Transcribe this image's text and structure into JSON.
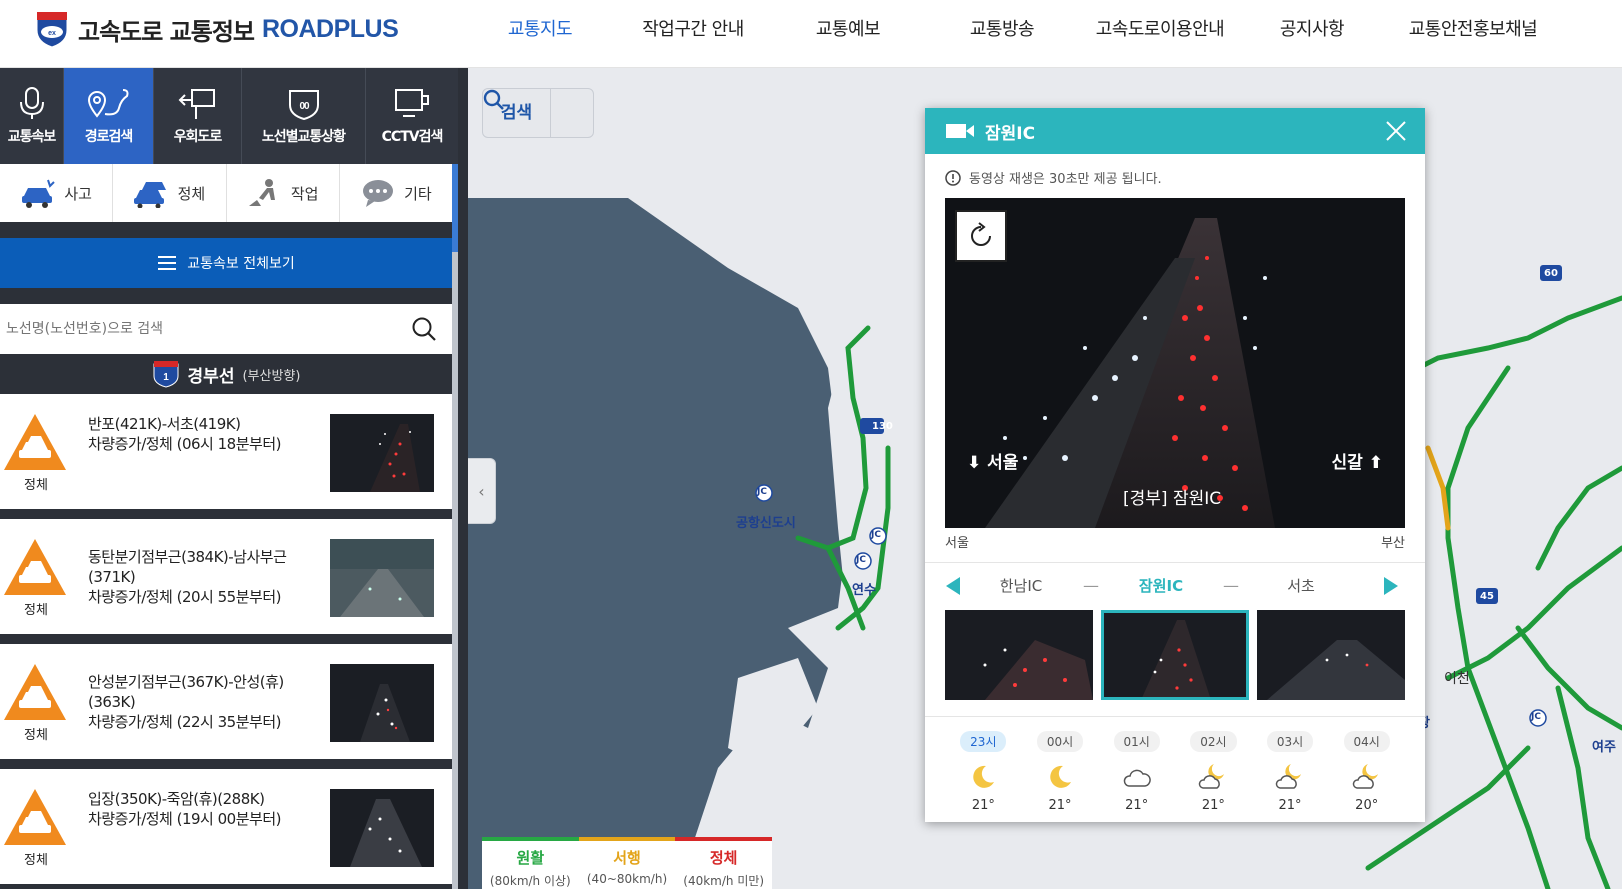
{
  "header": {
    "logo_kr": "고속도로 교통정보",
    "logo_en": "ROADPLUS",
    "nav": [
      "교통지도",
      "작업구간 안내",
      "교통예보",
      "교통방송",
      "고속도로이용안내",
      "공지사항",
      "교통안전홍보채널"
    ]
  },
  "sidebar": {
    "tabs": [
      "교통속보",
      "경로검색",
      "우회도로",
      "노선별교통상황",
      "CCTV검색"
    ],
    "categories": [
      "사고",
      "정체",
      "작업",
      "기타"
    ],
    "all_button": "교통속보 전체보기",
    "search_placeholder": "노선명(노선번호)으로 검색",
    "route": {
      "number": "1",
      "name": "경부선",
      "direction": "(부산방향)"
    },
    "incidents": [
      {
        "type": "정체",
        "line1": "반포(421K)-서초(419K)",
        "line2": "차량증가/정체 (06시 18분부터)"
      },
      {
        "type": "정체",
        "line1": "동탄분기점부근(384K)-남사부근(371K)",
        "line2": "차량증가/정체 (20시 55분부터)"
      },
      {
        "type": "정체",
        "line1": "안성분기점부근(367K)-안성(휴)(363K)",
        "line2": "차량증가/정체 (22시 35분부터)"
      },
      {
        "type": "정체",
        "line1": "입장(350K)-죽암(휴)(288K)",
        "line2": "차량증가/정체 (19시 00분부터)"
      }
    ]
  },
  "map": {
    "search_label": "검색",
    "labels": [
      "공항신도시",
      "연수",
      "이천",
      "여주",
      "마장"
    ],
    "jc": "JC",
    "route_numbers": [
      "130",
      "60",
      "45"
    ],
    "legend": [
      {
        "name": "원활",
        "range": "(80km/h 이상)",
        "color": "#27a844"
      },
      {
        "name": "서행",
        "range": "(40~80km/h)",
        "color": "#e3a41a"
      },
      {
        "name": "정체",
        "range": "(40km/h 미만)",
        "color": "#d62828"
      }
    ]
  },
  "popup": {
    "title": "잠원IC",
    "notice": "동영상 재생은 30초만 제공 됩니다.",
    "video": {
      "left_label": "서울",
      "right_label": "신갈",
      "caption": "[경부] 잠원IC"
    },
    "dir_left": "서울",
    "dir_right": "부산",
    "stations": {
      "prev": "한남IC",
      "current": "잠원IC",
      "next": "서초"
    },
    "dash": "—",
    "weather": [
      {
        "hour": "23시",
        "icon": "moon-icon",
        "temp": "21°"
      },
      {
        "hour": "00시",
        "icon": "moon-icon",
        "temp": "21°"
      },
      {
        "hour": "01시",
        "icon": "cloud-icon",
        "temp": "21°"
      },
      {
        "hour": "02시",
        "icon": "cloud-moon-icon",
        "temp": "21°"
      },
      {
        "hour": "03시",
        "icon": "cloud-moon-icon",
        "temp": "21°"
      },
      {
        "hour": "04시",
        "icon": "cloud-moon-icon",
        "temp": "20°"
      }
    ]
  }
}
